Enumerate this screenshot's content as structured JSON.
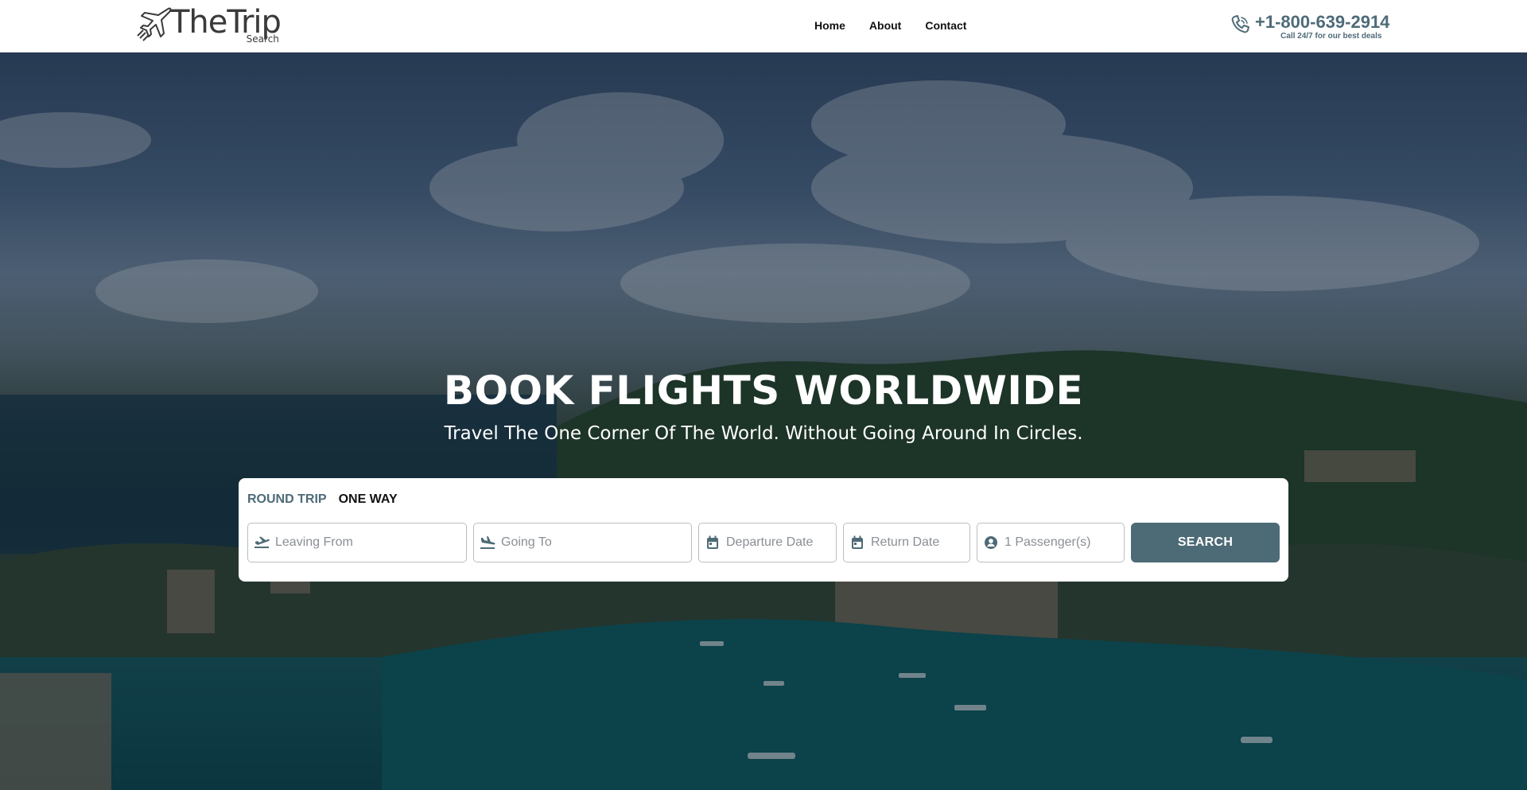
{
  "brand": {
    "name_main": "TheTrip",
    "name_sub": "Search",
    "logo_icon": "airplane-icon"
  },
  "nav": {
    "items": [
      {
        "label": "Home"
      },
      {
        "label": "About"
      },
      {
        "label": "Contact"
      }
    ]
  },
  "contact": {
    "icon": "phone-icon",
    "phone": "+1-800-639-2914",
    "note": "Call 24/7 for our best deals"
  },
  "hero": {
    "headline": "BOOK FLIGHTS WORLDWIDE",
    "subline": "Travel The One Corner Of The World. Without Going Around In Circles."
  },
  "search": {
    "tabs": [
      {
        "label": "ROUND TRIP",
        "active": true
      },
      {
        "label": "ONE WAY",
        "active": false
      }
    ],
    "fields": {
      "leaving_from": {
        "placeholder": "Leaving From",
        "value": "",
        "icon": "plane-departure-icon"
      },
      "going_to": {
        "placeholder": "Going To",
        "value": "",
        "icon": "plane-arrival-icon"
      },
      "departure_date": {
        "placeholder": "Departure Date",
        "value": "",
        "icon": "calendar-icon"
      },
      "return_date": {
        "placeholder": "Return Date",
        "value": "",
        "icon": "calendar-icon"
      },
      "passengers": {
        "placeholder": "1 Passenger(s)",
        "value": "",
        "icon": "user-circle-icon"
      }
    },
    "button_label": "SEARCH"
  },
  "colors": {
    "accent": "#4d6b76",
    "header_bg": "#ffffff",
    "hero_text": "#ffffff"
  }
}
